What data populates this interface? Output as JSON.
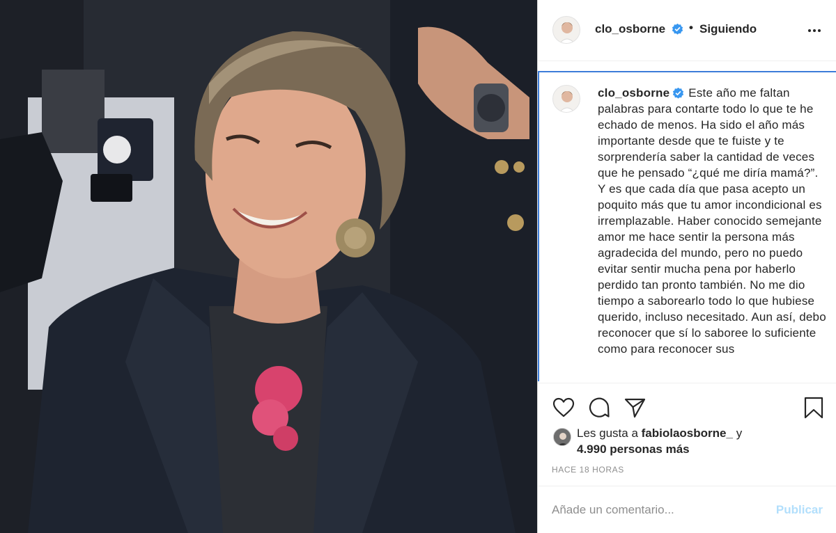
{
  "post": {
    "username": "clo_osborne",
    "separator": "•",
    "follow_status": "Siguiendo",
    "caption_username": "clo_osborne",
    "caption_text": "Este año me faltan palabras para contarte todo lo que te he echado de menos. Ha sido el año más importante desde que te fuiste y te sorprendería saber la cantidad de veces que he pensado “¿qué me diría mamá?”.\nY es que cada día que pasa acepto un poquito más que tu amor incondicional es irremplazable. Haber conocido semejante amor me hace sentir la persona más agradecida del mundo, pero no puedo evitar sentir mucha pena por haberlo perdido tan pronto también. No me dio tiempo a saborearlo todo lo que hubiese querido, incluso necesitado. Aun así, debo reconocer que sí lo saboree lo suficiente como para reconocer sus",
    "likes_prefix": "Les gusta a",
    "liked_by": "fabiolaosborne_",
    "likes_connector": "y",
    "likes_others": "4.990 personas más",
    "timestamp": "HACE 18 HORAS"
  },
  "comment": {
    "placeholder": "Añade un comentario...",
    "publish_label": "Publicar"
  },
  "icons": {
    "verified": "verified-badge-icon",
    "more": "more-options-icon",
    "like": "heart-icon",
    "comment": "comment-bubble-icon",
    "share": "paper-plane-icon",
    "save": "bookmark-icon"
  },
  "colors": {
    "verified_blue": "#3897f0",
    "publish_disabled": "#b2dffc",
    "focus_border": "#3c7cd9"
  }
}
